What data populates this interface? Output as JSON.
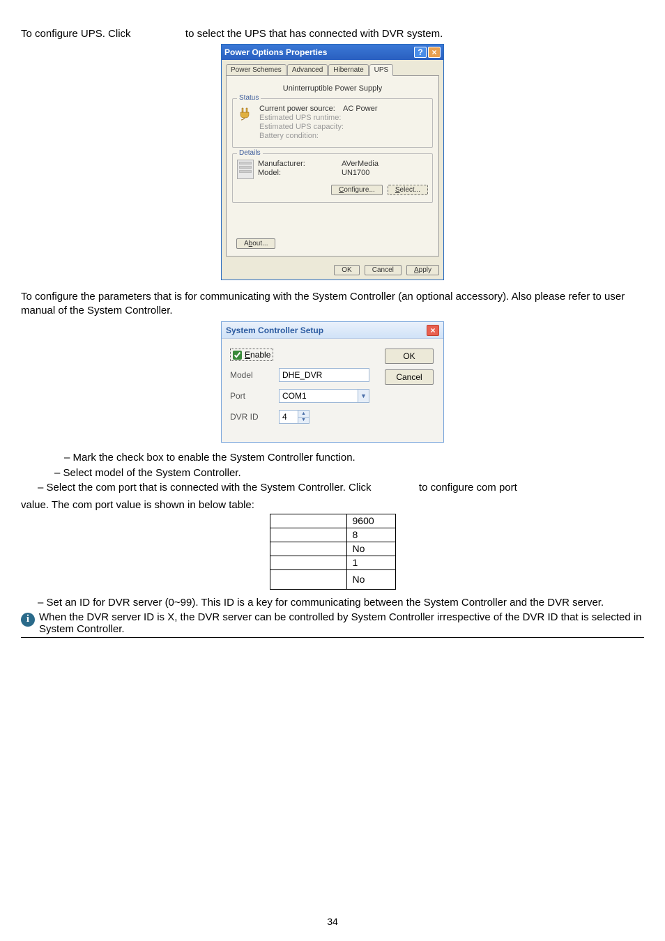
{
  "line1_a": "To configure UPS. Click",
  "line1_b": "to select the UPS that has connected with DVR system.",
  "powerDialog": {
    "title": "Power Options Properties",
    "tabs": {
      "t1": "Power Schemes",
      "t2": "Advanced",
      "t3": "Hibernate",
      "t4": "UPS"
    },
    "heading": "Uninterruptible Power Supply",
    "statusLegend": "Status",
    "status": {
      "l1k": "Current power source:",
      "l1v": "AC Power",
      "l2": "Estimated UPS runtime:",
      "l3": "Estimated UPS capacity:",
      "l4": "Battery condition:"
    },
    "detailsLegend": "Details",
    "details": {
      "mfk": "Manufacturer:",
      "mfv": "AVerMedia",
      "mdk": "Model:",
      "mdv": "UN1700"
    },
    "configureBtn": "Configure...",
    "selectBtn": "Select...",
    "aboutBtn": "About...",
    "okBtn": "OK",
    "cancelBtn": "Cancel",
    "applyBtn": "Apply"
  },
  "para2": "To configure the parameters that is for communicating with the System Controller (an optional accessory). Also please refer to user manual of the System Controller.",
  "scDialog": {
    "title": "System Controller Setup",
    "enable": "Enable",
    "model": "Model",
    "modelVal": "DHE_DVR",
    "port": "Port",
    "portVal": "COM1",
    "dvrid": "DVR ID",
    "dvridVal": "4",
    "ok": "OK",
    "cancel": "Cancel"
  },
  "bullets": {
    "b1": "– Mark the check box to enable the System Controller function.",
    "b2": "– Select model of the System Controller.",
    "b3a": "– Select the com port that is connected with the System Controller. Click",
    "b3b": "to configure com port",
    "b3c": "value. The com port value is shown in below table:"
  },
  "comtable": {
    "r1v": "9600",
    "r2v": "8",
    "r3v": "No",
    "r4v": "1",
    "r5v": "No"
  },
  "b4": "– Set an ID for DVR server (0~99). This ID is a key for communicating between the System Controller and the DVR server.",
  "note": "When the DVR server ID is X, the DVR server can be controlled by System Controller irrespective of the DVR ID that is selected in System Controller.",
  "pagenum": "34",
  "chart_data": {
    "type": "table",
    "rows": [
      {
        "label": "",
        "value": "9600"
      },
      {
        "label": "",
        "value": "8"
      },
      {
        "label": "",
        "value": "No"
      },
      {
        "label": "",
        "value": "1"
      },
      {
        "label": "",
        "value": "No"
      }
    ]
  }
}
